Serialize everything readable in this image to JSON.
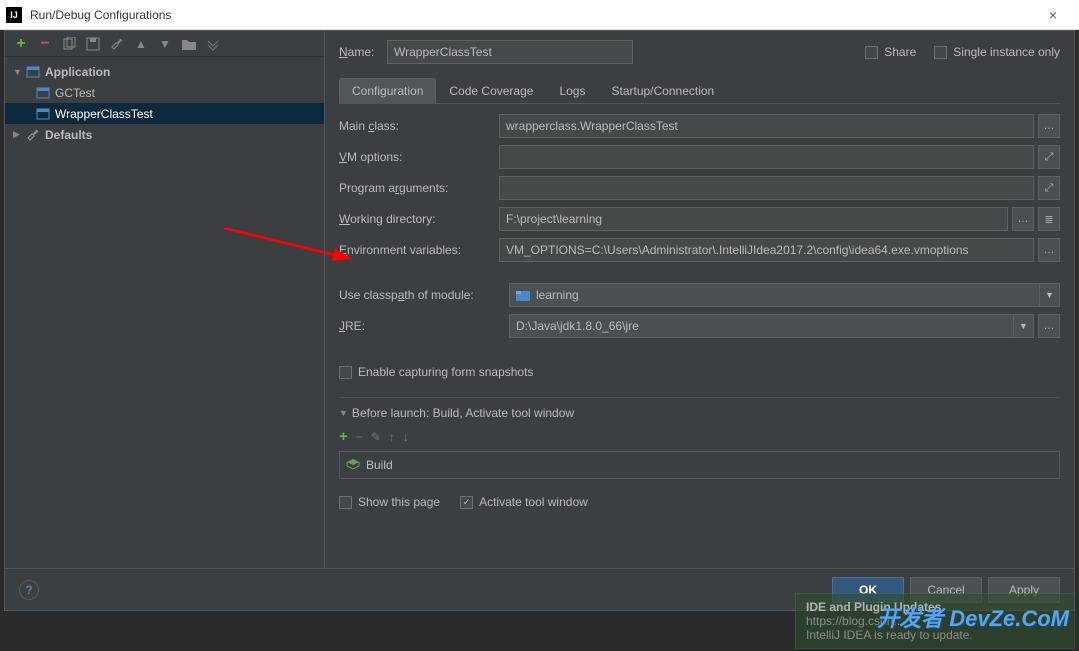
{
  "window": {
    "title": "Run/Debug Configurations",
    "close": "×"
  },
  "tree": {
    "app": "Application",
    "gctest": "GCTest",
    "wct": "WrapperClassTest",
    "defaults": "Defaults"
  },
  "form": {
    "name_lbl": "Name:",
    "name_val": "WrapperClassTest",
    "share": "Share",
    "single": "Single instance only",
    "tabs": {
      "conf": "Configuration",
      "cov": "Code Coverage",
      "logs": "Logs",
      "start": "Startup/Connection"
    },
    "main_class": {
      "lbl": "Main class:",
      "val": "wrapperclass.WrapperClassTest"
    },
    "vm": {
      "lbl": "VM options:",
      "val": ""
    },
    "args": {
      "lbl": "Program arguments:",
      "val": ""
    },
    "wd": {
      "lbl": "Working directory:",
      "val": "F:\\project\\learning"
    },
    "env": {
      "lbl": "Environment variables:",
      "val": "VM_OPTIONS=C:\\Users\\Administrator\\.IntelliJIdea2017.2\\config\\idea64.exe.vmoptions"
    },
    "cp": {
      "lbl": "Use classpath of module:",
      "val": "learning"
    },
    "jre": {
      "lbl": "JRE:",
      "val": "D:\\Java\\jdk1.8.0_66\\jre"
    },
    "snap": "Enable capturing form snapshots",
    "before": "Before launch: Build, Activate tool window",
    "build": "Build",
    "showpage": "Show this page",
    "activate": "Activate tool window"
  },
  "buttons": {
    "ok": "OK",
    "cancel": "Cancel",
    "apply": "Apply"
  },
  "notif": {
    "title": "IDE and Plugin Updates",
    "line1": "https://blog.csdn...",
    "line2": "IntelliJ IDEA is ready to update."
  },
  "watermark": "开发者 DevZe.CoM"
}
